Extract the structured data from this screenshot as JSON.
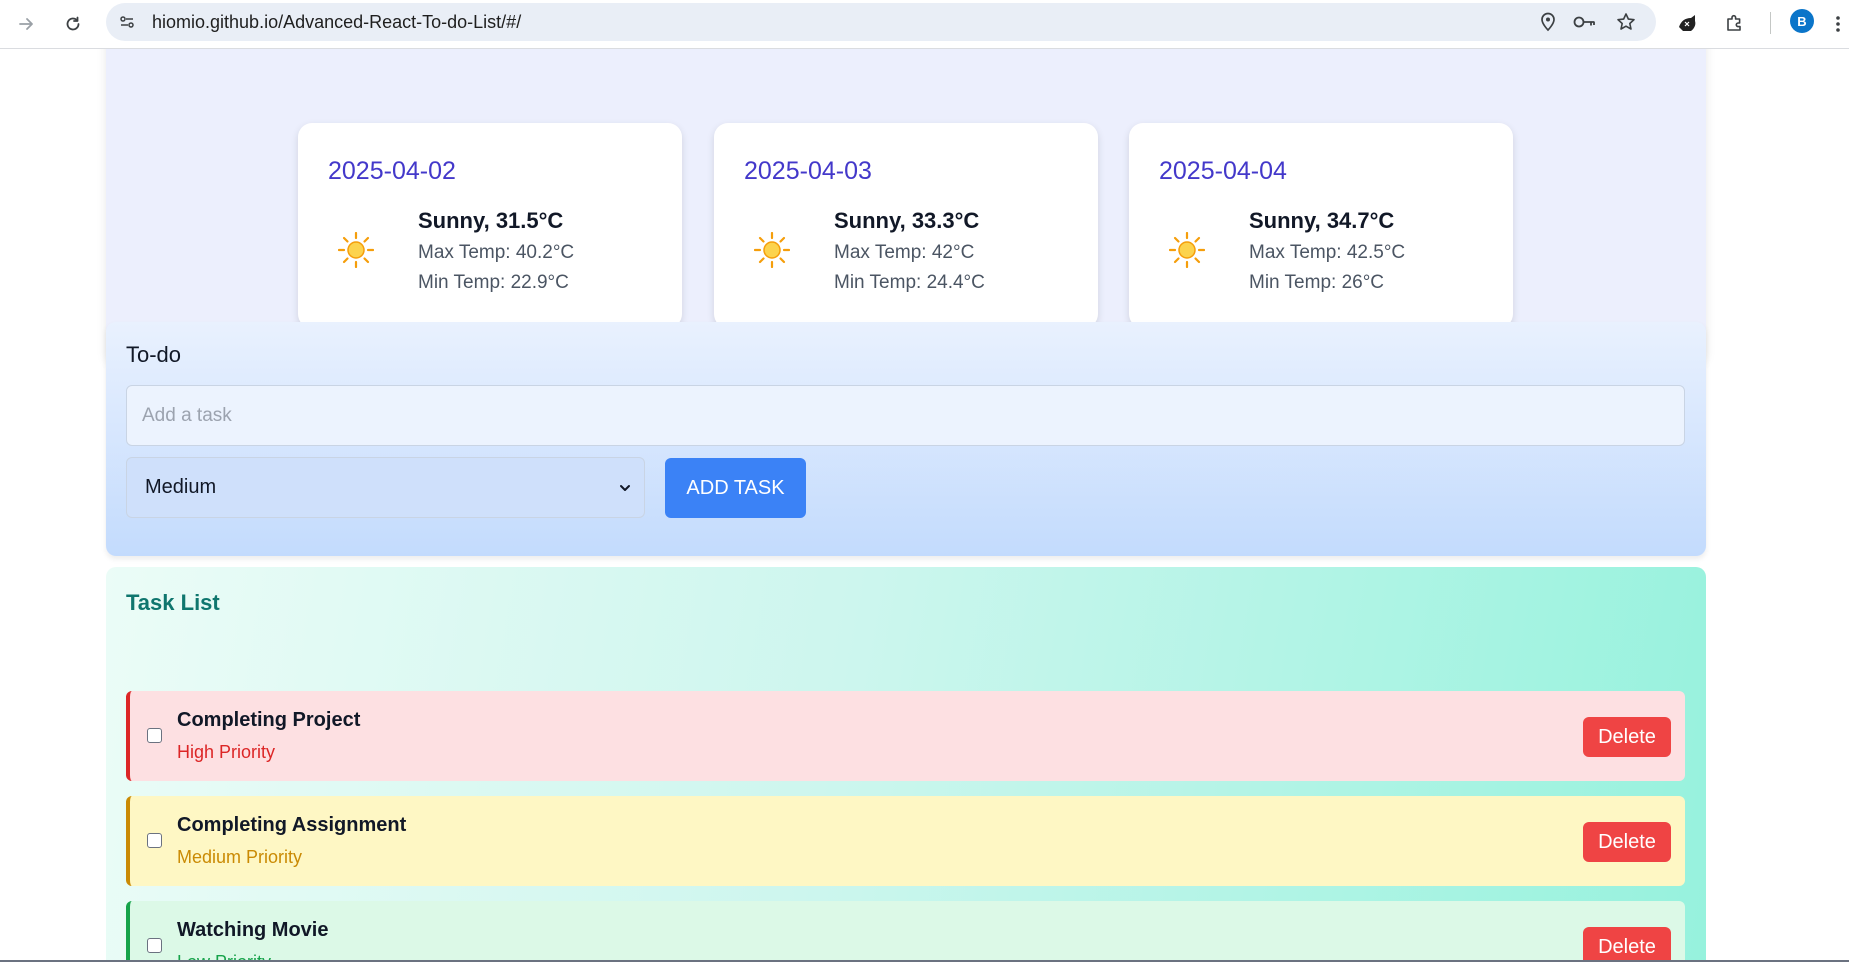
{
  "browser": {
    "url": "hiomio.github.io/Advanced-React-To-do-List/#/",
    "profile_initial": "B"
  },
  "weather": {
    "days": [
      {
        "date": "2025-04-02",
        "condition": "Sunny, 31.5°C",
        "max": "Max Temp: 40.2°C",
        "min": "Min Temp: 22.9°C",
        "icon": "sun-icon"
      },
      {
        "date": "2025-04-03",
        "condition": "Sunny, 33.3°C",
        "max": "Max Temp: 42°C",
        "min": "Min Temp: 24.4°C",
        "icon": "sun-icon"
      },
      {
        "date": "2025-04-04",
        "condition": "Sunny, 34.7°C",
        "max": "Max Temp: 42.5°C",
        "min": "Min Temp: 26°C",
        "icon": "sun-icon"
      }
    ]
  },
  "todo": {
    "title": "To-do",
    "input_placeholder": "Add a task",
    "input_value": "",
    "priority_selected": "Medium",
    "add_button": "ADD TASK"
  },
  "task_list": {
    "title": "Task List",
    "tasks": [
      {
        "name": "Completing Project",
        "priority": "High Priority",
        "delete_label": "Delete",
        "checked": false
      },
      {
        "name": "Completing Assignment",
        "priority": "Medium Priority",
        "delete_label": "Delete",
        "checked": false
      },
      {
        "name": "Watching Movie",
        "priority": "Low Priority",
        "delete_label": "Delete",
        "checked": false
      }
    ]
  },
  "colors": {
    "accent_blue": "#3b82f6",
    "date_indigo": "#4338ca",
    "delete_red": "#ef4444",
    "high": "#dc2626",
    "medium": "#ca8a04",
    "low": "#16a34a"
  }
}
